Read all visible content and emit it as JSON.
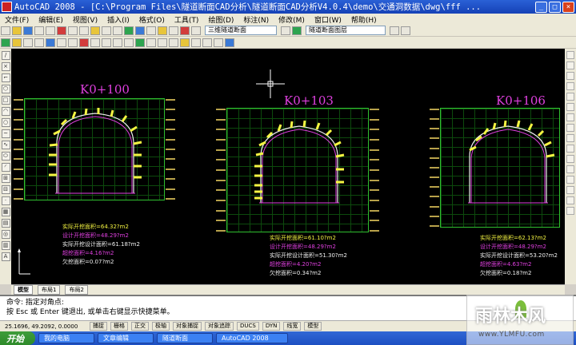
{
  "window": {
    "title": "AutoCAD 2008 - [C:\\Program Files\\隧道断面CAD分析\\隧道断面CAD分析V4.0.4\\demo\\交通洞数据\\dwg\\fff ..."
  },
  "menu": [
    "文件(F)",
    "编辑(E)",
    "视图(V)",
    "插入(I)",
    "格式(O)",
    "工具(T)",
    "绘图(D)",
    "标注(N)",
    "修改(M)",
    "窗口(W)",
    "帮助(H)"
  ],
  "toolbar": {
    "layer_combo": "三维隧道断面",
    "style_combo": "隧道断面图层"
  },
  "sections": [
    {
      "title": "K0+100",
      "results": [
        "实际开挖面积=64.32?m2",
        "设计开挖面积=48.29?m2",
        "实际开挖设计面积=61.18?m2",
        "超挖面积=4.16?m2",
        "欠挖面积=0.07?m2"
      ]
    },
    {
      "title": "K0+103",
      "results": [
        "实际开挖面积=61.10?m2",
        "设计开挖面积=48.29?m2",
        "实际开挖设计面积=51.30?m2",
        "超挖面积=4.20?m2",
        "欠挖面积=0.34?m2"
      ]
    },
    {
      "title": "K0+106",
      "results": [
        "实际开挖面积=62.13?m2",
        "设计开挖面积=48.29?m2",
        "实际开挖设计面积=53.20?m2",
        "超挖面积=4.63?m2",
        "欠挖面积=0.18?m2"
      ]
    }
  ],
  "layout_tabs": [
    "模型",
    "布局1",
    "布局2"
  ],
  "command": {
    "line1": "命令: 指定对角点:",
    "line2": "按 Esc 或 Enter 键退出, 或单击右键显示快捷菜单。"
  },
  "status": {
    "coords": "25.1696, 49.2092, 0.0000",
    "buttons": [
      "捕捉",
      "栅格",
      "正交",
      "极轴",
      "对象捕捉",
      "对象追踪",
      "DUCS",
      "DYN",
      "线宽",
      "模型"
    ]
  },
  "taskbar": {
    "start": "开始",
    "tasks": [
      "我的电脑",
      "文章编辑",
      "隧道断面",
      "AutoCAD 2008"
    ]
  },
  "watermark": {
    "text": "雨林木风",
    "url": "www.YLMFU.com"
  }
}
